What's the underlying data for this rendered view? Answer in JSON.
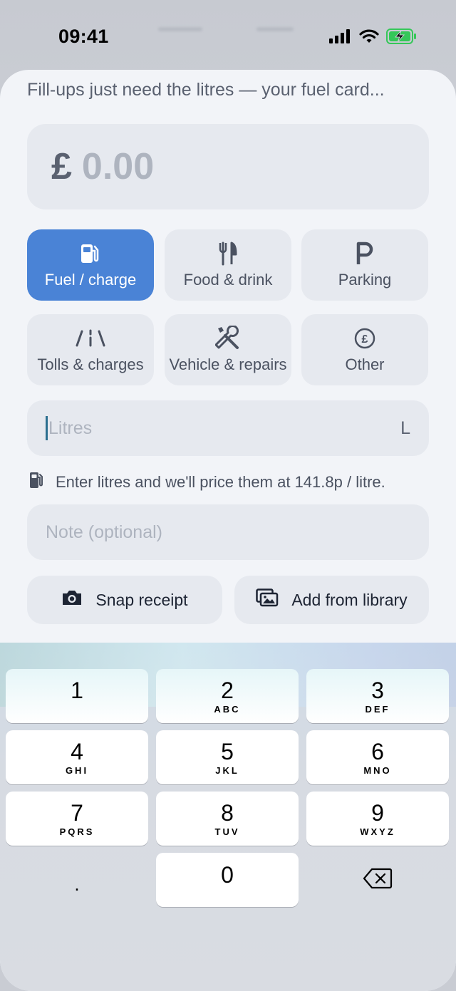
{
  "status_bar": {
    "time": "09:41"
  },
  "sheet": {
    "hint_text": "Fill-ups just need the litres — your fuel card...",
    "amount": {
      "currency": "£",
      "value": "0.00"
    },
    "categories": [
      {
        "label": "Fuel / charge",
        "icon": "fuel-pump-icon",
        "selected": true
      },
      {
        "label": "Food & drink",
        "icon": "fork-knife-icon",
        "selected": false
      },
      {
        "label": "Parking",
        "icon": "parking-p-icon",
        "selected": false
      },
      {
        "label": "Tolls & charges",
        "icon": "road-icon",
        "selected": false
      },
      {
        "label": "Vehicle & repairs",
        "icon": "wrench-screwdriver-icon",
        "selected": false
      },
      {
        "label": "Other",
        "icon": "pound-coin-icon",
        "selected": false
      }
    ],
    "litres_field": {
      "placeholder": "Litres",
      "unit": "L"
    },
    "price_hint": "Enter litres and we'll price them at 141.8p / litre.",
    "note_field": {
      "placeholder": "Note (optional)"
    },
    "buttons": {
      "snap_receipt": "Snap receipt",
      "add_from_library": "Add from library"
    }
  },
  "keypad": {
    "keys": [
      {
        "num": "1",
        "letters": ""
      },
      {
        "num": "2",
        "letters": "ABC"
      },
      {
        "num": "3",
        "letters": "DEF"
      },
      {
        "num": "4",
        "letters": "GHI"
      },
      {
        "num": "5",
        "letters": "JKL"
      },
      {
        "num": "6",
        "letters": "MNO"
      },
      {
        "num": "7",
        "letters": "PQRS"
      },
      {
        "num": "8",
        "letters": "TUV"
      },
      {
        "num": "9",
        "letters": "WXYZ"
      },
      {
        "num": ".",
        "letters": ""
      },
      {
        "num": "0",
        "letters": ""
      }
    ]
  },
  "colors": {
    "accent": "#4a83d6",
    "sheet_bg": "#f2f4f8",
    "field_bg": "#e6e9ef"
  }
}
